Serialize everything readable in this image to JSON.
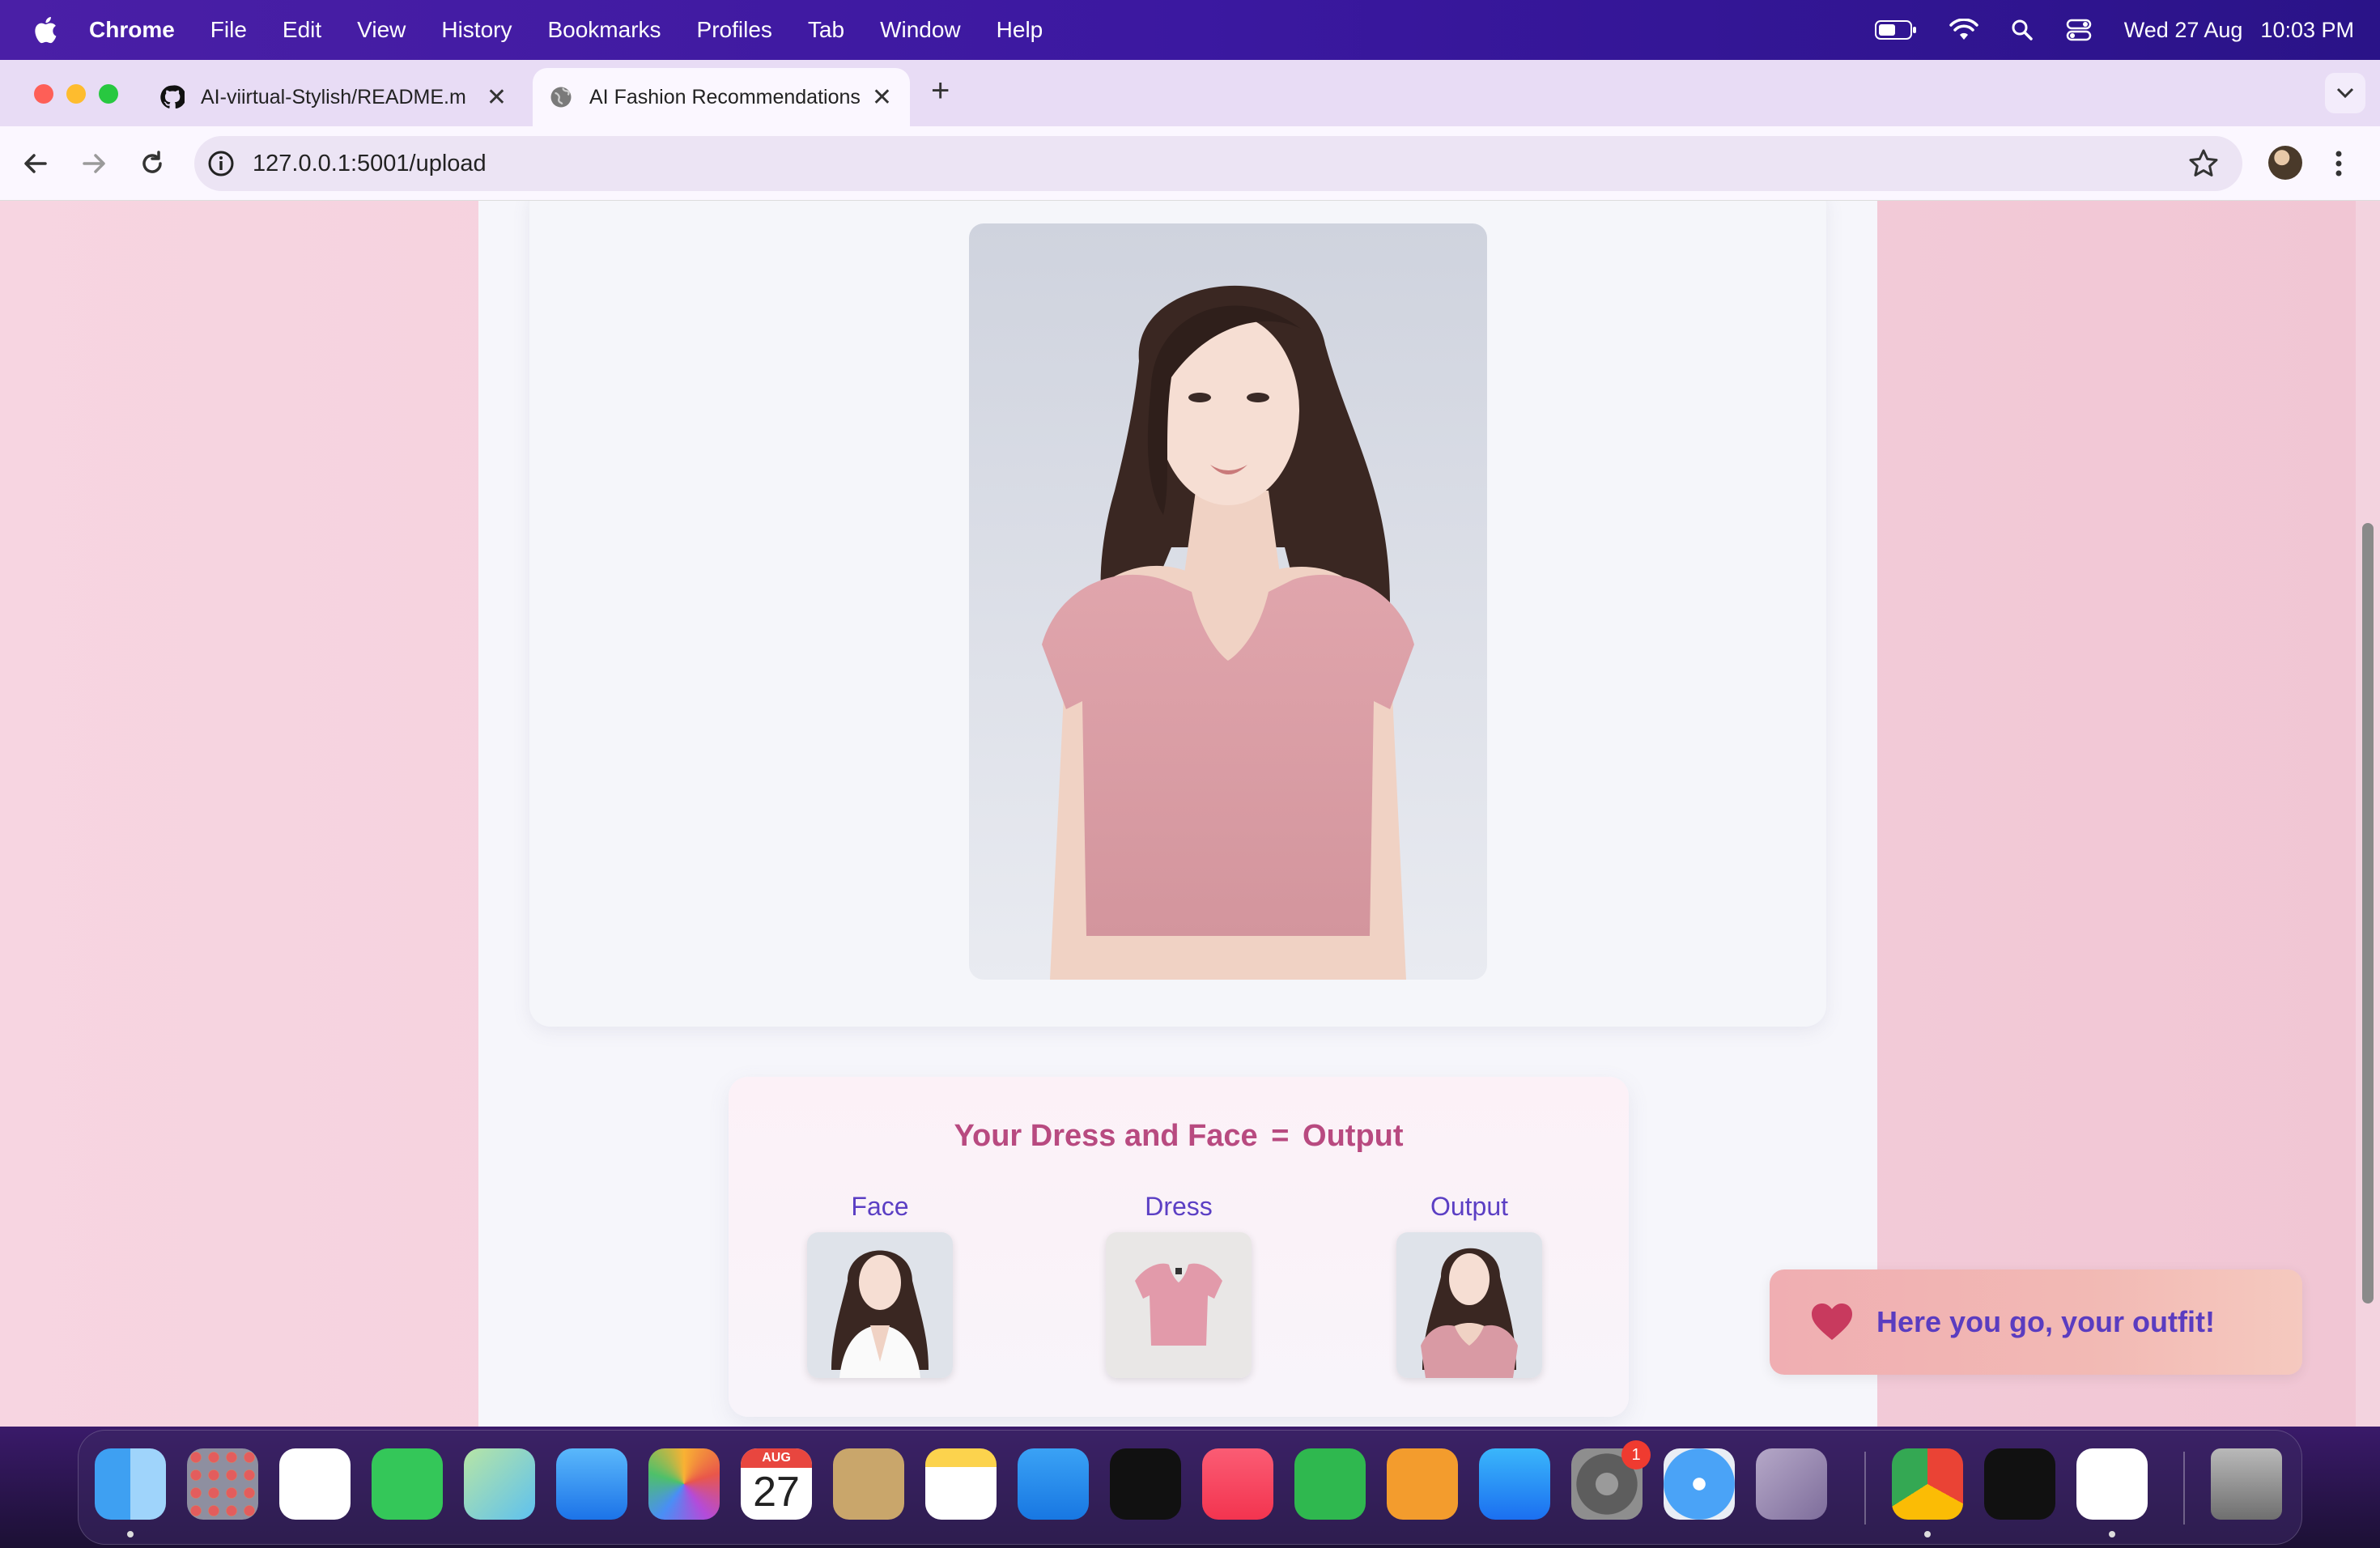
{
  "menubar": {
    "app_name": "Chrome",
    "items": [
      "File",
      "Edit",
      "View",
      "History",
      "Bookmarks",
      "Profiles",
      "Tab",
      "Window",
      "Help"
    ],
    "date": "Wed 27 Aug",
    "time": "10:03 PM"
  },
  "browser": {
    "tabs": [
      {
        "title": "AI-viirtual-Stylish/README.m",
        "favicon": "github-icon",
        "active": false
      },
      {
        "title": "AI Fashion Recommendations",
        "favicon": "globe-icon",
        "active": true
      }
    ],
    "new_tab_label": "+",
    "url": "127.0.0.1:5001/upload"
  },
  "page": {
    "result": {
      "title": "Your Dress and Face",
      "equals": "=",
      "output_word": "Output",
      "labels": {
        "face": "Face",
        "dress": "Dress",
        "output": "Output"
      }
    },
    "toast": {
      "message": "Here you go, your outfit!",
      "icon": "heart-icon"
    }
  },
  "dock": {
    "apps": [
      "Finder",
      "Launchpad",
      "Reminders",
      "Messages",
      "Maps",
      "Mail",
      "Photos",
      "Calendar",
      "Contacts",
      "Notes",
      "Keynote",
      "TV",
      "Music",
      "Numbers",
      "Pages",
      "App Store",
      "System Settings",
      "Safari",
      "iPhone Mirroring",
      "Chrome",
      "Unity",
      "Visual Studio Code",
      "Trash"
    ],
    "calendar_month": "AUG",
    "calendar_day": "27",
    "settings_badge": "1"
  },
  "colors": {
    "menubar": "#3b18a0",
    "title_pink": "#b84a80",
    "label_purple": "#5b3fc4",
    "toast_text": "#5a3cc0",
    "page_bg": "#f4cfdc"
  }
}
